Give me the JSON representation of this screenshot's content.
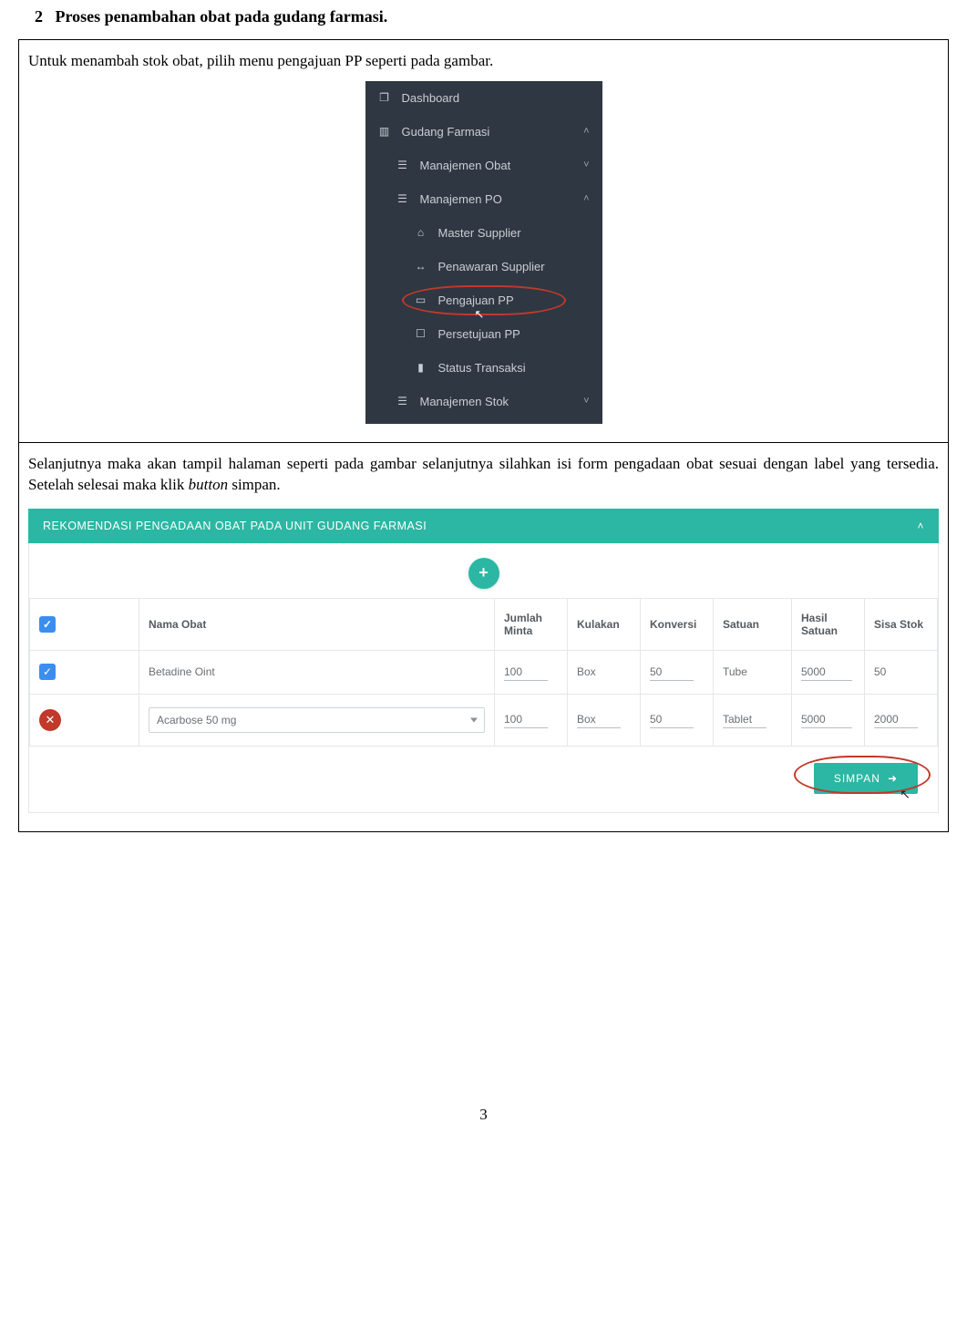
{
  "heading_num": "2",
  "heading_text": "Proses penambahan obat pada gudang farmasi.",
  "para1": "Untuk menambah stok obat, pilih menu pengajuan PP seperti pada gambar.",
  "para2_a": "Selanjutnya maka akan tampil halaman seperti pada gambar selanjutnya silahkan isi form pengadaan obat sesuai dengan label yang tersedia. Setelah selesai maka klik ",
  "para2_button_word": "button",
  "para2_b": " simpan.",
  "sidebar": {
    "dashboard": "Dashboard",
    "gudang": "Gudang Farmasi",
    "man_obat": "Manajemen Obat",
    "man_po": "Manajemen PO",
    "master_supplier": "Master Supplier",
    "penawaran_supplier": "Penawaran Supplier",
    "pengajuan_pp": "Pengajuan PP",
    "persetujuan_pp": "Persetujuan PP",
    "status_transaksi": "Status Transaksi",
    "man_stok": "Manajemen Stok"
  },
  "panel": {
    "title": "REKOMENDASI PENGADAAN OBAT PADA UNIT GUDANG FARMASI",
    "add_label": "+",
    "headers": {
      "nama_obat": "Nama Obat",
      "jumlah_minta": "Jumlah Minta",
      "kulakan": "Kulakan",
      "konversi": "Konversi",
      "satuan": "Satuan",
      "hasil_satuan": "Hasil Satuan",
      "sisa_stok": "Sisa Stok"
    },
    "rows": [
      {
        "checked": true,
        "removable": false,
        "nama": "Betadine Oint",
        "jumlah": "100",
        "kulakan": "Box",
        "konversi": "50",
        "satuan": "Tube",
        "hasil": "5000",
        "sisa": "50",
        "nama_is_select": false
      },
      {
        "checked": false,
        "removable": true,
        "nama": "Acarbose 50 mg",
        "jumlah": "100",
        "kulakan": "Box",
        "konversi": "50",
        "satuan": "Tablet",
        "hasil": "5000",
        "sisa": "2000",
        "nama_is_select": true
      }
    ],
    "save_label": "SIMPAN",
    "save_icon": "➜"
  },
  "page_number": "3"
}
